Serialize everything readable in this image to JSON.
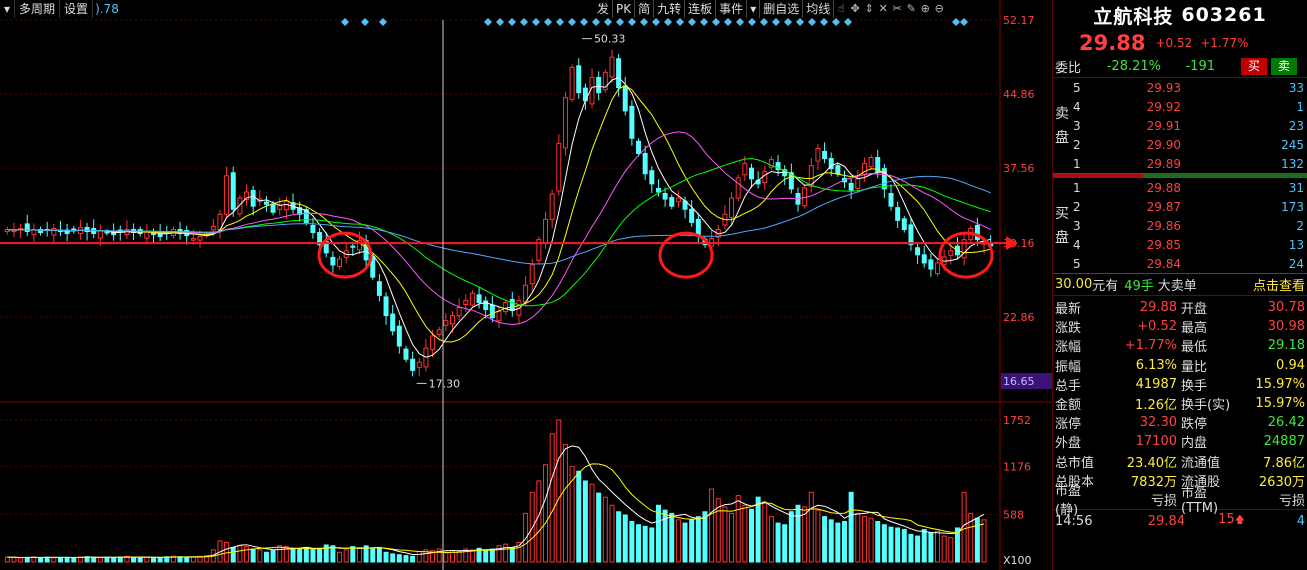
{
  "toolbar_left": {
    "menu_arrow": "▾",
    "multi_period": "多周期",
    "settings": "设置",
    "value_tail": ").78"
  },
  "toolbar_right": {
    "items": [
      "发",
      "PK",
      "简",
      "九转",
      "连板",
      "事件",
      "▾",
      "删自选",
      "均线"
    ],
    "icons": [
      "hand-icon",
      "pan-icon",
      "scale-icon",
      "cross-icon",
      "scissors-icon",
      "draw-icon",
      "zoom-in-icon",
      "zoom-out-icon"
    ]
  },
  "chart_data": {
    "type": "candlestick",
    "price_axis_ticks": [
      "52.17",
      "44.86",
      "37.56",
      "30.16",
      "22.86"
    ],
    "price_axis_min_label": "16.65",
    "volume_axis_ticks": [
      "1752",
      "1176",
      "588"
    ],
    "volume_unit": "X100",
    "high_annotation": "50.33",
    "low_annotation": "17.30",
    "support_line_price": 30.16,
    "price_range": [
      16.65,
      52.17
    ],
    "volume_max": 1752,
    "colors": {
      "up": "#ff3030",
      "down": "#54ffff",
      "ma5": "#ffffff",
      "ma10": "#ffff00",
      "ma20": "#ff55ff",
      "ma30": "#00ff00",
      "ma60": "#4fa8ff",
      "support": "#ff1a1a"
    },
    "closes": [
      31.5,
      31.4,
      31.6,
      31.3,
      31.5,
      31.2,
      31.4,
      31.6,
      31.3,
      31.1,
      31.4,
      31.7,
      31.3,
      31.1,
      31.4,
      31.2,
      31.0,
      31.3,
      31.5,
      31.2,
      31.1,
      31.3,
      31.0,
      30.8,
      31.2,
      31.5,
      31.1,
      30.9,
      30.6,
      30.8,
      31.0,
      31.8,
      33.0,
      36.8,
      33.5,
      34.6,
      35.2,
      33.8,
      34.5,
      34.0,
      33.2,
      33.9,
      34.3,
      33.5,
      33.0,
      32.2,
      31.2,
      30.0,
      29.2,
      28.0,
      28.6,
      29.4,
      29.8,
      30.4,
      28.5,
      26.8,
      25.0,
      23.0,
      21.5,
      20.0,
      18.7,
      17.6,
      18.4,
      19.8,
      21.0,
      21.6,
      22.5,
      23.0,
      23.8,
      24.5,
      25.2,
      24.3,
      23.6,
      22.8,
      23.4,
      24.3,
      23.5,
      24.5,
      26.0,
      28.0,
      30.5,
      32.5,
      35.0,
      40.0,
      44.5,
      47.5,
      45.0,
      44.2,
      46.5,
      45.0,
      47.0,
      48.5,
      45.5,
      43.2,
      40.5,
      39.0,
      37.0,
      36.0,
      35.2,
      34.5,
      33.8,
      34.6,
      33.5,
      32.2,
      31.0,
      30.0,
      30.6,
      31.5,
      33.0,
      34.6,
      36.6,
      38.0,
      36.5,
      36.0,
      37.2,
      38.4,
      37.4,
      36.8,
      35.5,
      34.0,
      35.6,
      37.8,
      39.5,
      38.5,
      37.5,
      37.0,
      36.2,
      35.4,
      36.5,
      38.0,
      38.6,
      37.2,
      35.5,
      33.8,
      32.4,
      31.5,
      30.0,
      29.0,
      28.2,
      27.6,
      28.2,
      28.8,
      29.4,
      29.0,
      30.5,
      31.6,
      30.5,
      30.2,
      29.88
    ],
    "volumes": [
      60,
      55,
      50,
      58,
      62,
      54,
      60,
      52,
      56,
      58,
      50,
      62,
      66,
      58,
      52,
      60,
      56,
      62,
      70,
      55,
      58,
      60,
      54,
      52,
      64,
      72,
      66,
      58,
      62,
      70,
      80,
      150,
      260,
      240,
      180,
      200,
      190,
      160,
      150,
      120,
      140,
      200,
      190,
      170,
      160,
      180,
      150,
      170,
      210,
      200,
      120,
      150,
      190,
      180,
      200,
      160,
      170,
      120,
      100,
      90,
      80,
      70,
      130,
      150,
      140,
      160,
      120,
      140,
      130,
      160,
      150,
      170,
      140,
      160,
      200,
      220,
      180,
      240,
      600,
      860,
      1000,
      1200,
      1580,
      1752,
      1450,
      1180,
      1120,
      1000,
      960,
      850,
      800,
      700,
      620,
      580,
      500,
      460,
      440,
      420,
      700,
      640,
      600,
      520,
      480,
      520,
      560,
      620,
      900,
      780,
      680,
      600,
      820,
      700,
      650,
      800,
      740,
      560,
      480,
      460,
      620,
      700,
      680,
      860,
      640,
      560,
      520,
      480,
      500,
      860,
      600,
      560,
      540,
      500,
      460,
      430,
      420,
      400,
      340,
      320,
      400,
      360,
      380,
      320,
      300,
      420,
      860,
      600,
      540,
      520
    ]
  },
  "panel": {
    "name": "立航科技",
    "code": "603261",
    "price": "29.88",
    "change": "+0.52",
    "change_pct": "+1.77%",
    "weibi_label": "委比",
    "weibi_pct": "-28.21%",
    "weibi_diff": "-191",
    "buy_btn": "买",
    "sell_btn": "卖",
    "sell_side_label": [
      "卖",
      "盘"
    ],
    "buy_side_label": [
      "买",
      "盘"
    ],
    "asks": [
      {
        "lvl": "5",
        "price": "29.93",
        "vol": "33"
      },
      {
        "lvl": "4",
        "price": "29.92",
        "vol": "1"
      },
      {
        "lvl": "3",
        "price": "29.91",
        "vol": "23"
      },
      {
        "lvl": "2",
        "price": "29.90",
        "vol": "245"
      },
      {
        "lvl": "1",
        "price": "29.89",
        "vol": "132"
      }
    ],
    "bids": [
      {
        "lvl": "1",
        "price": "29.88",
        "vol": "31"
      },
      {
        "lvl": "2",
        "price": "29.87",
        "vol": "173"
      },
      {
        "lvl": "3",
        "price": "29.86",
        "vol": "2"
      },
      {
        "lvl": "4",
        "price": "29.85",
        "vol": "13"
      },
      {
        "lvl": "5",
        "price": "29.84",
        "vol": "24"
      }
    ],
    "big_order": {
      "price": "30.00",
      "suffix": "元有",
      "qty": "49手",
      "label": "大卖单",
      "link": "点击查看"
    },
    "stats": [
      {
        "l1": "最新",
        "v1": "29.88",
        "c1": "c-red",
        "l2": "开盘",
        "v2": "30.78",
        "c2": "c-red"
      },
      {
        "l1": "涨跌",
        "v1": "+0.52",
        "c1": "c-red",
        "l2": "最高",
        "v2": "30.98",
        "c2": "c-red"
      },
      {
        "l1": "涨幅",
        "v1": "+1.77%",
        "c1": "c-red",
        "l2": "最低",
        "v2": "29.18",
        "c2": "c-green"
      },
      {
        "l1": "振幅",
        "v1": "6.13%",
        "c1": "c-yellow",
        "l2": "量比",
        "v2": "0.94",
        "c2": "c-yellow"
      },
      {
        "l1": "总手",
        "v1": "41987",
        "c1": "c-yellow",
        "l2": "换手",
        "v2": "15.97%",
        "c2": "c-yellow"
      },
      {
        "l1": "金额",
        "v1": "1.26亿",
        "c1": "c-yellow",
        "l2": "换手(实)",
        "v2": "15.97%",
        "c2": "c-yellow"
      },
      {
        "l1": "涨停",
        "v1": "32.30",
        "c1": "c-red",
        "l2": "跌停",
        "v2": "26.42",
        "c2": "c-green"
      },
      {
        "l1": "外盘",
        "v1": "17100",
        "c1": "c-red",
        "l2": "内盘",
        "v2": "24887",
        "c2": "c-green"
      },
      {
        "l1": "总市值",
        "v1": "23.40亿",
        "c1": "c-yellow",
        "l2": "流通值",
        "v2": "7.86亿",
        "c2": "c-yellow"
      },
      {
        "l1": "总股本",
        "v1": "7832万",
        "c1": "c-yellow",
        "l2": "流通股",
        "v2": "2630万",
        "c2": "c-yellow"
      },
      {
        "l1": "市盈(静)",
        "v1": "亏损",
        "c1": "c-white",
        "l2": "市盈(TTM)",
        "v2": "亏损",
        "c2": "c-white"
      }
    ],
    "tick": {
      "time": "14:56",
      "price": "29.84",
      "vol": "15",
      "arrow": "🡅",
      "num": "4"
    }
  }
}
